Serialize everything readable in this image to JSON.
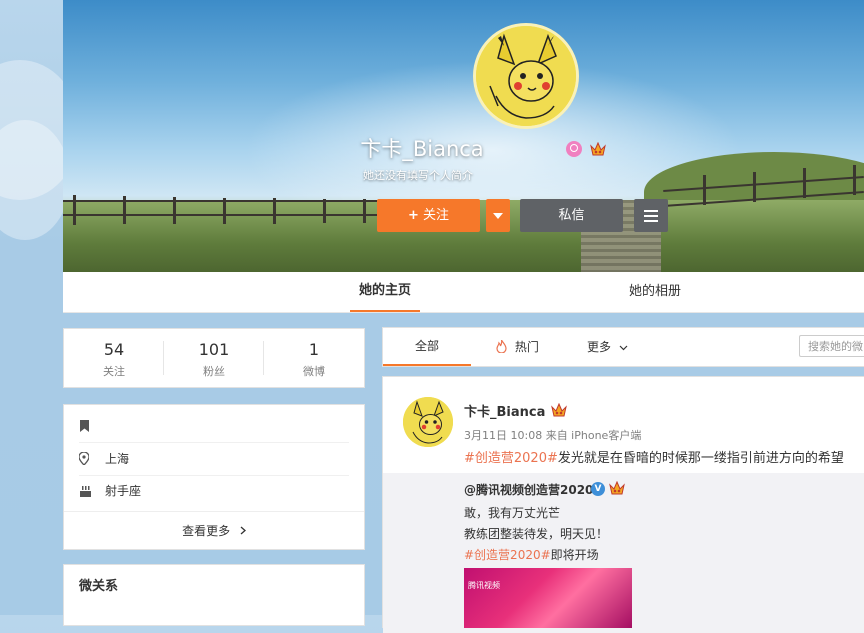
{
  "profile": {
    "name": "卞卡_Bianca",
    "bio": "她还没有填写个人简介",
    "follow_label": "关注",
    "message_label": "私信"
  },
  "tabs": {
    "home": "她的主页",
    "album": "她的相册"
  },
  "stats": [
    {
      "value": "54",
      "label": "关注"
    },
    {
      "value": "101",
      "label": "粉丝"
    },
    {
      "value": "1",
      "label": "微博"
    }
  ],
  "info": {
    "location": "上海",
    "zodiac": "射手座",
    "more": "查看更多"
  },
  "relation_title": "微关系",
  "feed_tabs": {
    "all": "全部",
    "hot": "热门",
    "more": "更多"
  },
  "search_placeholder": "搜索她的微",
  "post": {
    "author": "卞卡_Bianca",
    "meta": "3月11日 10:08 来自 iPhone客户端",
    "hashtag": "#创造营2020#",
    "text": "发光就是在昏暗的时候那一缕指引前进方向的希望",
    "repost": {
      "author": "@腾讯视频创造营2020",
      "line1": "敢，我有万丈光芒",
      "line2": "教练团整装待发，明天见！",
      "line3_hashtag": "#创造营2020#",
      "line3_text": "即将开场",
      "image_logo": "腾讯视频"
    }
  },
  "colors": {
    "accent": "#f6782a",
    "hashtag": "#eb7350",
    "dark_button": "#5f6266"
  }
}
